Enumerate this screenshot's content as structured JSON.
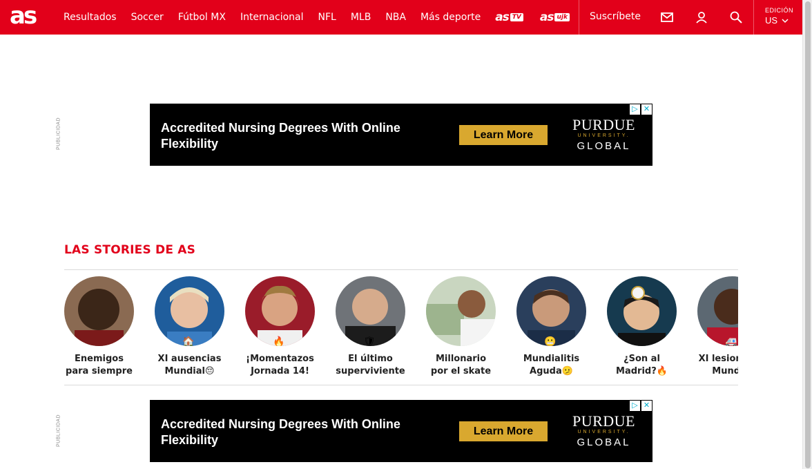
{
  "header": {
    "logo": "as",
    "nav": [
      "Resultados",
      "Soccer",
      "Fútbol MX",
      "Internacional",
      "NFL",
      "MLB",
      "NBA",
      "Más deporte"
    ],
    "brands": [
      {
        "name": "as",
        "tag": "TV"
      },
      {
        "name": "as",
        "tag": "ujk"
      }
    ],
    "subscribe": "Suscríbete",
    "icons": [
      "mail-icon",
      "user-icon",
      "search-icon"
    ],
    "edition_label": "EDICIÓN",
    "edition_value": "US"
  },
  "ads": [
    {
      "pub_label": "PUBLICIDAD",
      "headline": "Accredited Nursing Degrees With Online Flexibility",
      "cta": "Learn More",
      "brand_top": "PURDUE",
      "brand_mid": "UNIVERSITY.",
      "brand_bottom": "GLOBAL"
    },
    {
      "pub_label": "PUBLICIDAD",
      "headline": "Accredited Nursing Degrees With Online Flexibility",
      "cta": "Learn More",
      "brand_top": "PURDUE",
      "brand_mid": "UNIVERSITY.",
      "brand_bottom": "GLOBAL"
    }
  ],
  "stories": {
    "title": "LAS STORIES DE AS",
    "items": [
      {
        "title": "Enemigos para siempre",
        "badge": ""
      },
      {
        "title": "XI ausencias Mundial😔",
        "badge": "🏠"
      },
      {
        "title": "¡Momentazos Jornada 14!",
        "badge": "🔥"
      },
      {
        "title": "El último superviviente",
        "badge": "🛡"
      },
      {
        "title": "Millonario por el skate",
        "badge": ""
      },
      {
        "title": "Mundialitis Aguda🫤",
        "badge": "😬"
      },
      {
        "title": "¿Son al Madrid?🔥",
        "badge": ""
      },
      {
        "title": "XI lesionados Mundial",
        "badge": "🚑"
      }
    ]
  },
  "colors": {
    "brand_red": "#e2001a",
    "ad_gold": "#d9a82f"
  }
}
